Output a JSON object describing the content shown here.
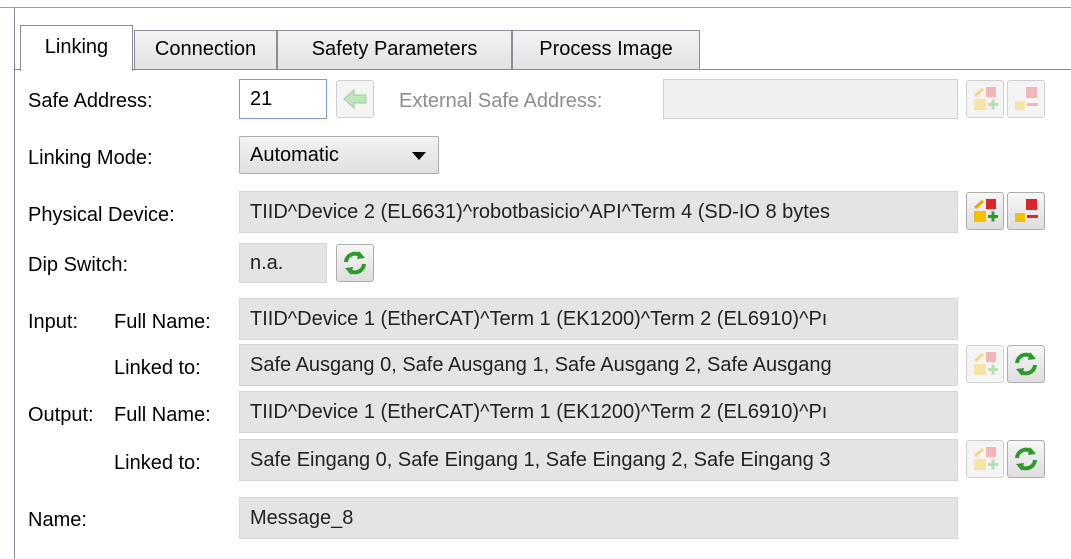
{
  "tabs": [
    {
      "label": "Linking"
    },
    {
      "label": "Connection"
    },
    {
      "label": "Safety Parameters"
    },
    {
      "label": "Process Image"
    }
  ],
  "safe_address": {
    "label": "Safe Address:",
    "value": "21",
    "external_label": "External Safe Address:",
    "external_value": ""
  },
  "linking_mode": {
    "label": "Linking Mode:",
    "value": "Automatic"
  },
  "physical_device": {
    "label": "Physical Device:",
    "value": "TIID^Device 2 (EL6631)^robotbasicio^API^Term 4 (SD-IO 8 bytes"
  },
  "dip_switch": {
    "label": "Dip Switch:",
    "value": "n.a."
  },
  "input": {
    "group_label": "Input:",
    "full_name_label": "Full Name:",
    "full_name_value": "TIID^Device 1 (EtherCAT)^Term 1 (EK1200)^Term 2 (EL6910)^Pı",
    "linked_label": "Linked to:",
    "linked_value": "Safe Ausgang 0, Safe Ausgang 1, Safe Ausgang 2, Safe Ausgang"
  },
  "output": {
    "group_label": "Output:",
    "full_name_label": "Full Name:",
    "full_name_value": "TIID^Device 1 (EtherCAT)^Term 1 (EK1200)^Term 2 (EL6910)^Pı",
    "linked_label": "Linked to:",
    "linked_value": "Safe Eingang 0, Safe Eingang 1, Safe Eingang 2, Safe Eingang 3"
  },
  "name": {
    "label": "Name:",
    "value": "Message_8"
  },
  "icons": {
    "arrow_left": "arrow-left-icon",
    "link_add": "link-add-icon",
    "link_remove": "link-remove-icon",
    "refresh": "refresh-icon"
  },
  "colors": {
    "field_bg": "#e4e4e4",
    "refresh_green": "#2e9a2e",
    "link_red": "#d9262b",
    "link_yellow": "#f2c200"
  }
}
